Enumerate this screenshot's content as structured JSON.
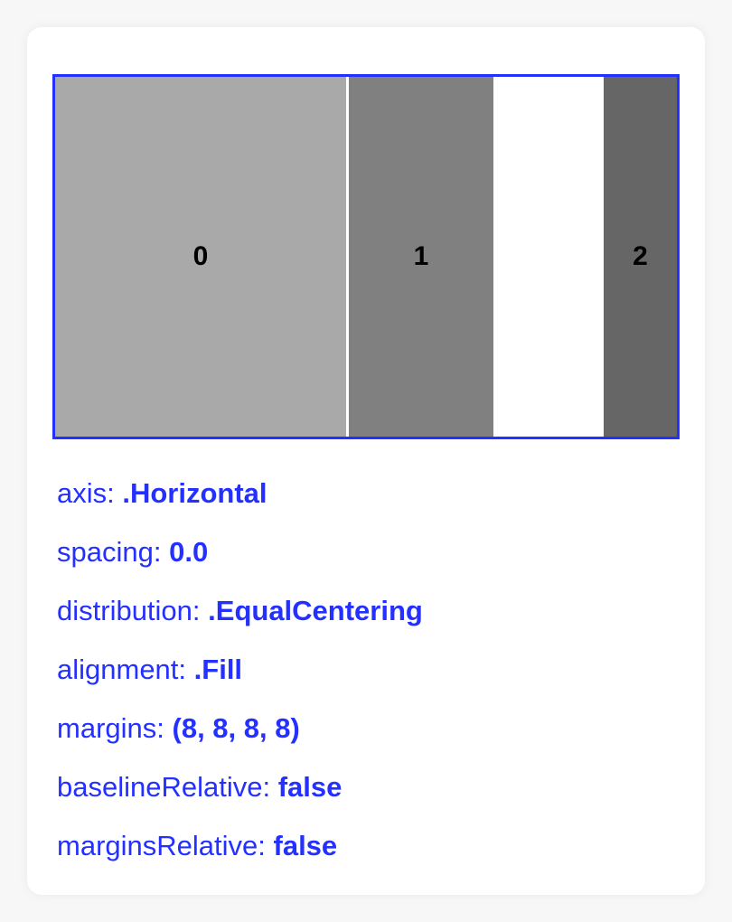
{
  "stack_views": [
    {
      "label": "0",
      "color": "#a9a9a9"
    },
    {
      "label": "1",
      "color": "#808080"
    },
    {
      "label": "2",
      "color": "#666666"
    }
  ],
  "border_color": "#2430ff",
  "text_color": "#2430ff",
  "properties": [
    {
      "name": "axis:",
      "value": ".Horizontal"
    },
    {
      "name": "spacing:",
      "value": "0.0"
    },
    {
      "name": "distribution:",
      "value": ".EqualCentering"
    },
    {
      "name": "alignment:",
      "value": ".Fill"
    },
    {
      "name": "margins:",
      "value": "(8, 8, 8, 8)"
    },
    {
      "name": "baselineRelative:",
      "value": "false"
    },
    {
      "name": "marginsRelative:",
      "value": "false"
    }
  ]
}
